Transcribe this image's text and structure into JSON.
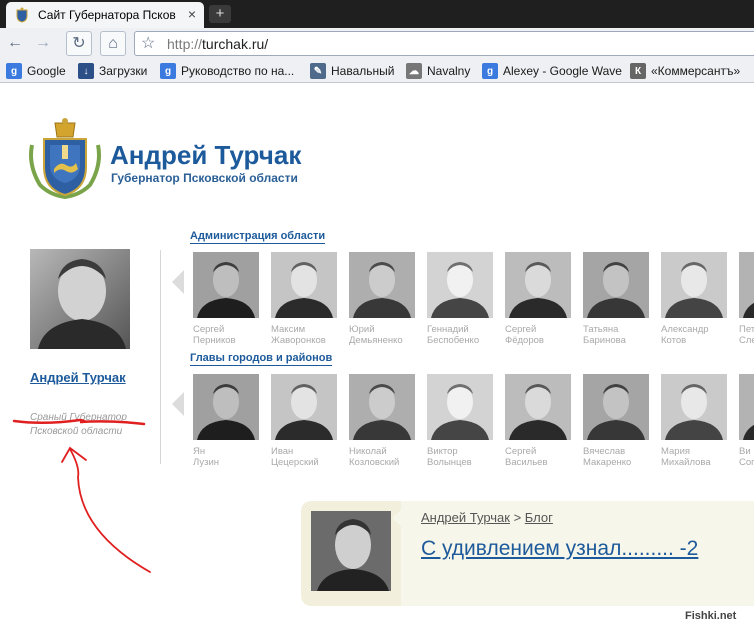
{
  "browser": {
    "tab_title": "Сайт Губернатора Псков",
    "new_tab_symbol": "+",
    "close_symbol": "×",
    "url_scheme": "http://",
    "url_host": "turchak.ru/"
  },
  "bookmarks": [
    {
      "label": "Google",
      "icon": "google-icon",
      "color": "#3b7be0"
    },
    {
      "label": "Загрузки",
      "icon": "download-icon",
      "color": "#2b4f86"
    },
    {
      "label": "Руководство по на...",
      "icon": "google-icon",
      "color": "#3b7be0"
    },
    {
      "label": "Навальный",
      "icon": "pen-icon",
      "color": "#4f6a8a"
    },
    {
      "label": "Navalny",
      "icon": "chat-icon",
      "color": "#777777"
    },
    {
      "label": "Alexey - Google Wave",
      "icon": "google-icon",
      "color": "#3b7be0"
    },
    {
      "label": "«Коммерсантъ»",
      "icon": "kommersant-icon",
      "color": "#666666"
    }
  ],
  "site": {
    "title": "Андрей Турчак",
    "subtitle": "Губернатор Псковской области"
  },
  "governor": {
    "name": "Андрей Турчак",
    "role_line1": "Сраный Губернатор",
    "role_line2": "Псковской области"
  },
  "admin": {
    "heading": "Администрация области",
    "people": [
      {
        "first": "Сергей",
        "last": "Перников"
      },
      {
        "first": "Максим",
        "last": "Жаворонков"
      },
      {
        "first": "Юрий",
        "last": "Демьяненко"
      },
      {
        "first": "Геннадий",
        "last": "Беспобенко"
      },
      {
        "first": "Сергей",
        "last": "Фёдоров"
      },
      {
        "first": "Татьяна",
        "last": "Баринова"
      },
      {
        "first": "Александр",
        "last": "Котов"
      },
      {
        "first": "Пет",
        "last": "Сле"
      }
    ]
  },
  "heads": {
    "heading": "Главы городов и районов",
    "people": [
      {
        "first": "Ян",
        "last": "Лузин"
      },
      {
        "first": "Иван",
        "last": "Цецерский"
      },
      {
        "first": "Николай",
        "last": "Козловский"
      },
      {
        "first": "Виктор",
        "last": "Волынцев"
      },
      {
        "first": "Сергей",
        "last": "Васильев"
      },
      {
        "first": "Вячеслав",
        "last": "Макаренко"
      },
      {
        "first": "Мария",
        "last": "Михайлова"
      },
      {
        "first": "Ви",
        "last": "Сог"
      }
    ]
  },
  "blog": {
    "crumb_author": "Андрей Турчак",
    "crumb_sep": " > ",
    "crumb_section": "Блог",
    "post_title": "С удивлением узнал......... -2"
  },
  "watermark": "Fishki.net",
  "colors": {
    "accent": "#1d5a9b",
    "annotation": "#e02020"
  }
}
